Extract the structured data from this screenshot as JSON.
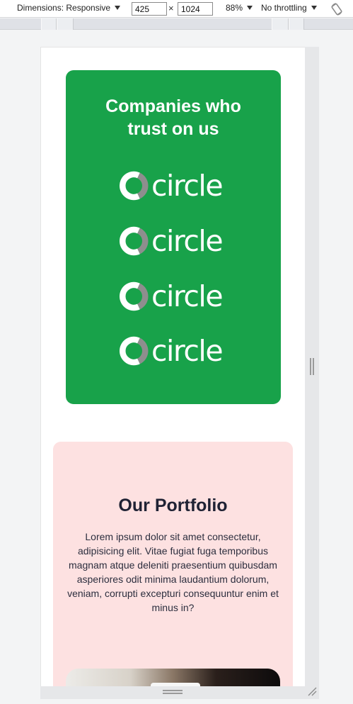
{
  "devtools": {
    "dimensions_label": "Dimensions: Responsive",
    "width_value": "425",
    "height_value": "1024",
    "times_symbol": "×",
    "zoom_label": "88%",
    "throttling_label": "No throttling"
  },
  "trust": {
    "title": "Companies who trust on us",
    "background_color": "#18a24a",
    "logos": [
      {
        "name": "circle"
      },
      {
        "name": "circle"
      },
      {
        "name": "circle"
      },
      {
        "name": "circle"
      }
    ]
  },
  "portfolio": {
    "title": "Our Portfolio",
    "body": "Lorem ipsum dolor sit amet consectetur, adipisicing elit. Vitae fugiat fuga temporibus magnam atque deleniti praesentium quibusdam asperiores odit minima laudantium dolorum, veniam, corrupti excepturi consequuntur enim et minus in?",
    "background_color": "#fde1e1"
  }
}
